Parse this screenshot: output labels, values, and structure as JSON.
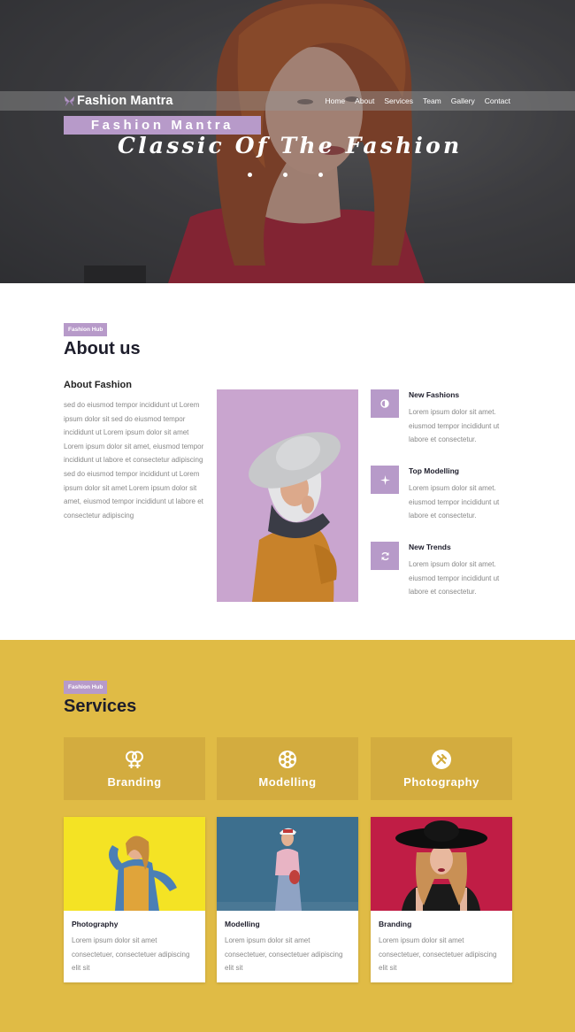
{
  "colors": {
    "accent": "#b79ac9",
    "services_bg": "#e0bb45",
    "service_box": "#d3ac3f",
    "heading": "#1d1d2b",
    "body_text": "#888888"
  },
  "header": {
    "logo_icon": "butterfly-icon",
    "logo_text": "Fashion Mantra",
    "nav": [
      "Home",
      "About",
      "Services",
      "Team",
      "Gallery",
      "Contact"
    ]
  },
  "hero": {
    "badge": "Fashion Mantra",
    "title": "Classic Of The Fashion",
    "slide_count": 3
  },
  "about": {
    "tag": "Fashion Hub",
    "title": "About us",
    "subtitle": "About Fashion",
    "text": "sed do eiusmod tempor incididunt ut Lorem ipsum dolor sit sed do eiusmod tempor incididunt ut Lorem ipsum dolor sit amet Lorem ipsum dolor sit amet, eiusmod tempor incididunt ut labore et consectetur adipiscing sed do eiusmod tempor incididunt ut Lorem ipsum dolor sit amet Lorem ipsum dolor sit amet, eiusmod tempor incididunt ut labore et consectetur adipiscing",
    "features": [
      {
        "icon": "half-circle-icon",
        "title": "New Fashions",
        "text": "Lorem ipsum dolor sit amet. eiusmod tempor incididunt ut labore et consectetur."
      },
      {
        "icon": "sparkle-icon",
        "title": "Top Modelling",
        "text": "Lorem ipsum dolor sit amet. eiusmod tempor incididunt ut labore et consectetur."
      },
      {
        "icon": "refresh-icon",
        "title": "New Trends",
        "text": "Lorem ipsum dolor sit amet. eiusmod tempor incididunt ut labore et consectetur."
      }
    ]
  },
  "services": {
    "tag": "Fashion Hub",
    "title": "Services",
    "boxes": [
      {
        "icon": "gender-rings-icon",
        "label": "Branding"
      },
      {
        "icon": "film-reel-icon",
        "label": "Modelling"
      },
      {
        "icon": "tools-icon",
        "label": "Photography"
      }
    ],
    "cards": [
      {
        "title": "Photography",
        "text": "Lorem ipsum dolor sit amet consectetuer, consectetuer adipiscing elit sit"
      },
      {
        "title": "Modelling",
        "text": "Lorem ipsum dolor sit amet consectetuer, consectetuer adipiscing elit sit"
      },
      {
        "title": "Branding",
        "text": "Lorem ipsum dolor sit amet consectetuer, consectetuer adipiscing elit sit"
      }
    ]
  }
}
